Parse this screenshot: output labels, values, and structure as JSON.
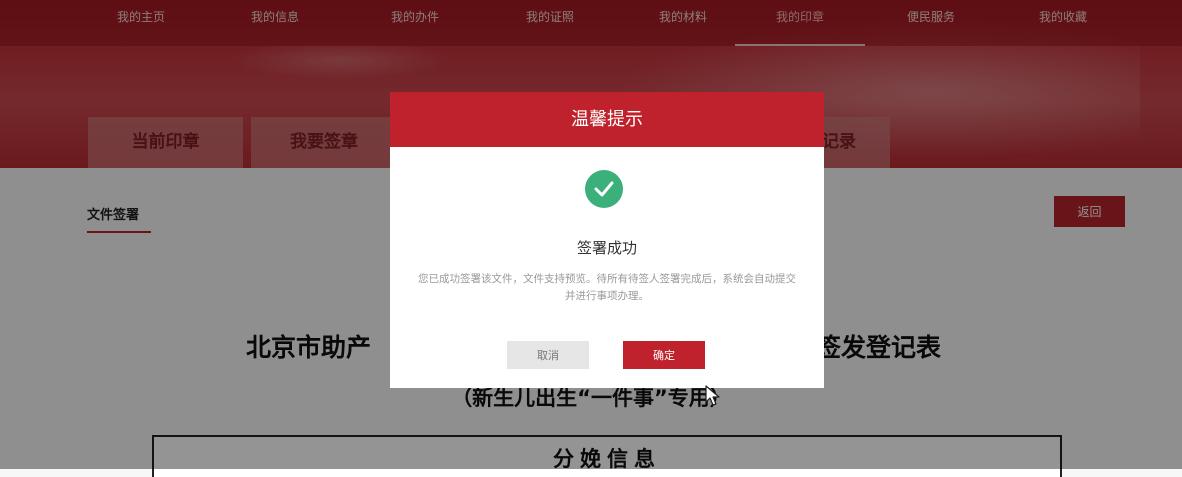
{
  "nav": {
    "items": [
      "我的主页",
      "我的信息",
      "我的办件",
      "我的证照",
      "我的材料",
      "我的印章",
      "便民服务",
      "我的收藏"
    ],
    "active_index": 5
  },
  "tabs": [
    "当前印章",
    "我要签章",
    "记录"
  ],
  "content": {
    "breadcrumb": "文件签署",
    "back_label": "返回",
    "doc_title_left": "北京市助产",
    "doc_title_right": "签发登记表",
    "doc_subtitle": "（新生儿出生“一件事”专用）",
    "table_header": "分娩信息"
  },
  "dialog": {
    "title": "温馨提示",
    "status": "签署成功",
    "message": "您已成功签署该文件，文件支持预览。待所有待签人签署完成后，系统会自动提交并进行事项办理。",
    "cancel_label": "取消",
    "confirm_label": "确定",
    "success_icon": "check-circle-icon"
  },
  "colors": {
    "brand_red": "#c0222d",
    "success_green": "#3bb07a"
  }
}
